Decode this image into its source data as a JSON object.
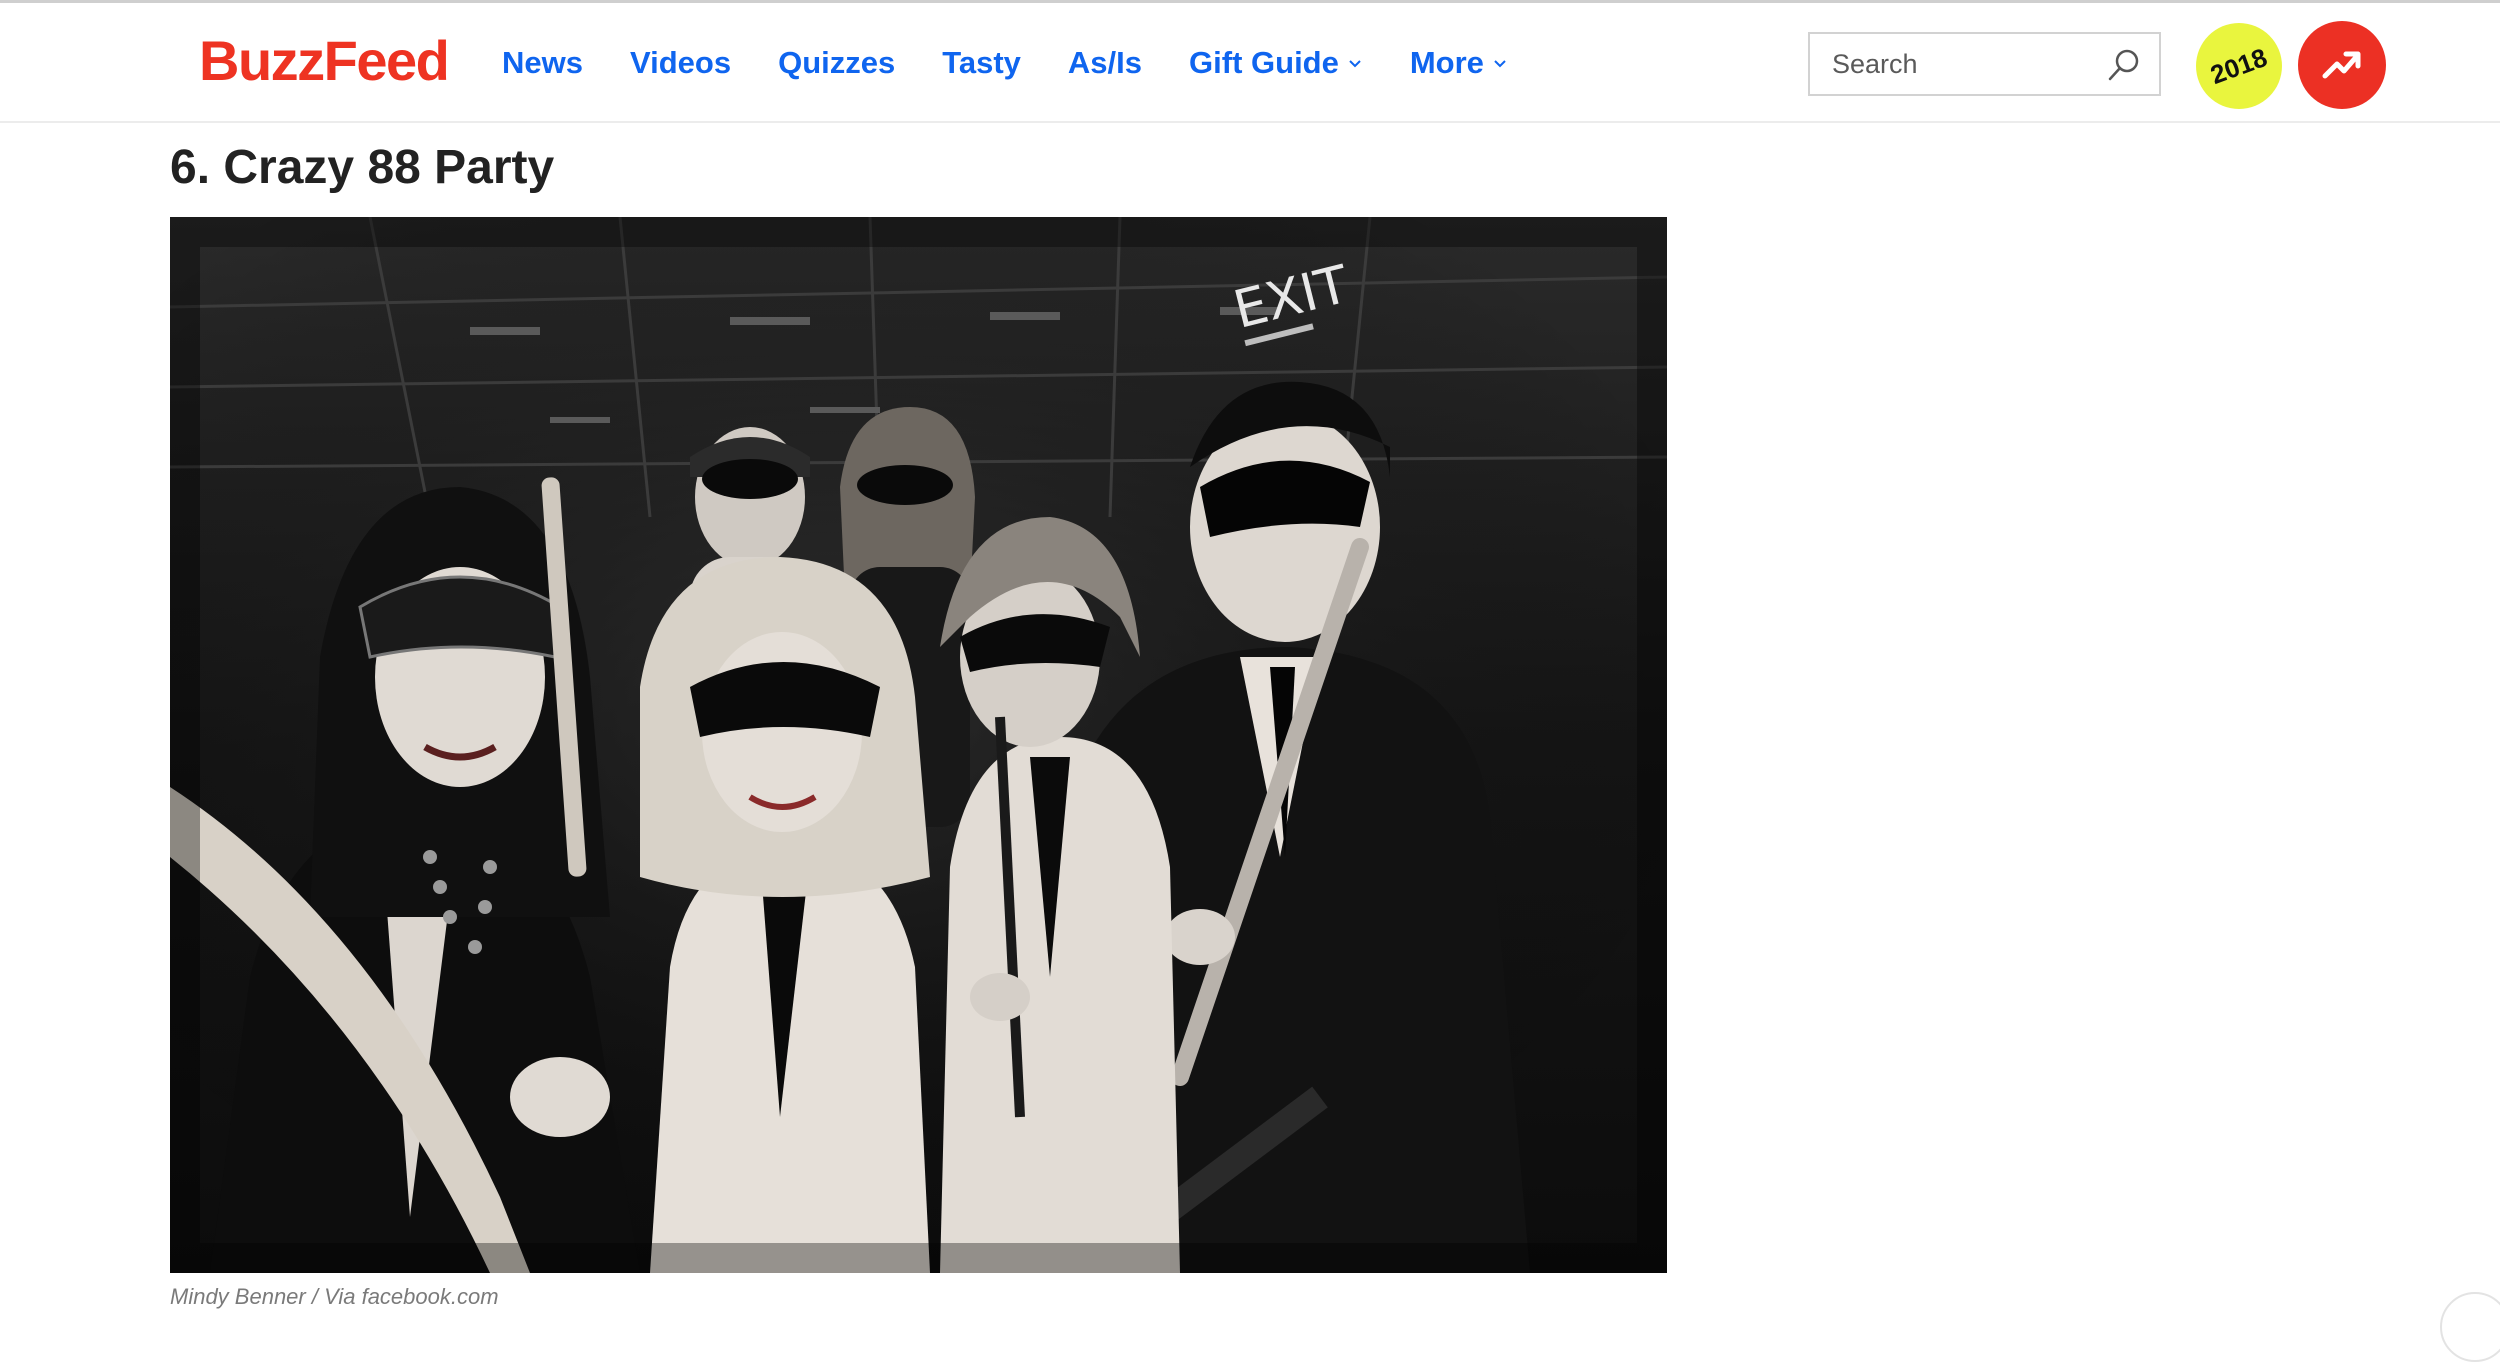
{
  "header": {
    "logo": "BuzzFeed",
    "nav": [
      {
        "label": "News"
      },
      {
        "label": "Videos"
      },
      {
        "label": "Quizzes"
      },
      {
        "label": "Tasty"
      },
      {
        "label": "As/Is"
      },
      {
        "label": "Gift Guide",
        "dropdown": true
      },
      {
        "label": "More",
        "dropdown": true
      }
    ],
    "search": {
      "placeholder": "Search",
      "icon": "search-icon"
    },
    "year_badge": "2018",
    "trending_icon": "trending-arrow-icon"
  },
  "article": {
    "item_title": "6. Crazy 88 Party",
    "photo": {
      "sign_text": "EXIT"
    },
    "credit": "Mindy Benner / Via facebook.com"
  },
  "colors": {
    "brand_red": "#ee3322",
    "nav_blue": "#0f65ef",
    "badge_yellow": "#e9f53e",
    "trending_red": "#ec3024"
  }
}
